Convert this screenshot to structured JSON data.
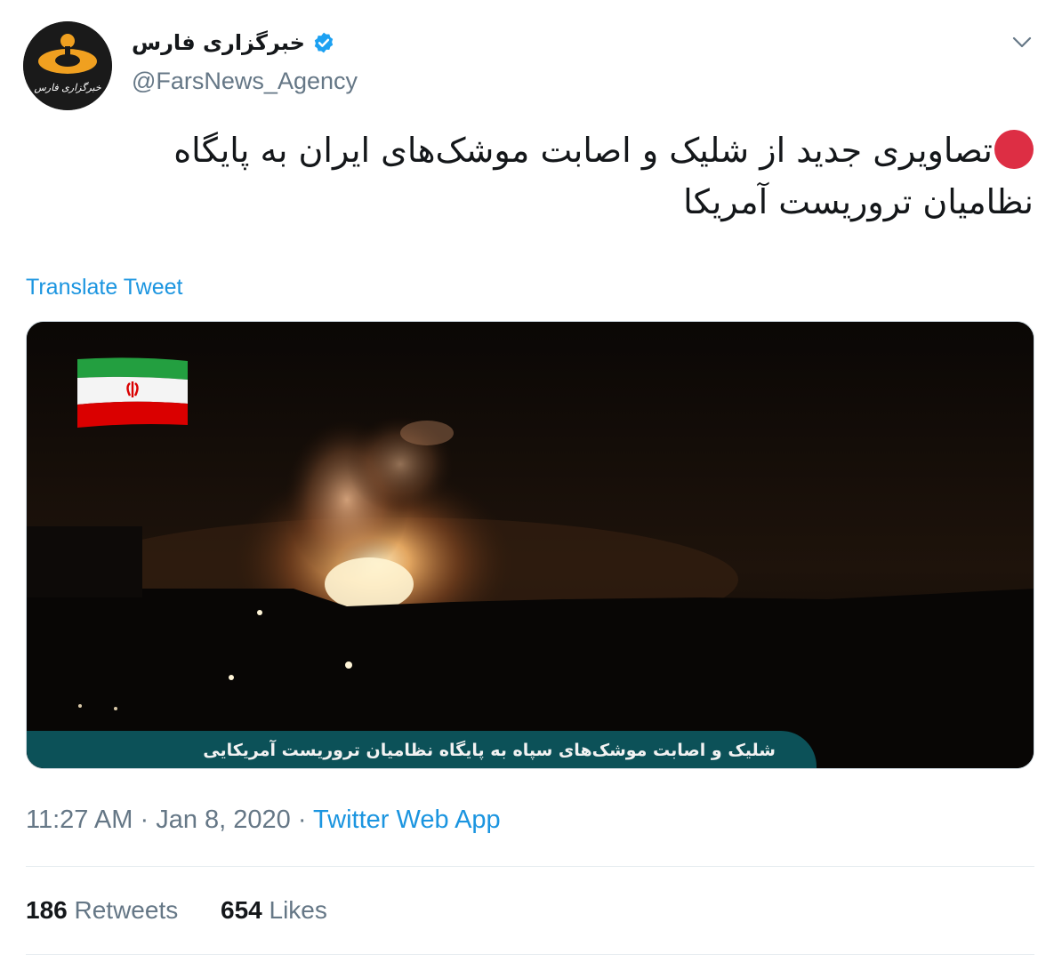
{
  "author": {
    "display_name": "خبرگزاری فارس",
    "handle": "@FarsNews_Agency",
    "verified": true,
    "avatar_text": "خبرگزاری فارس",
    "avatar_colors": {
      "background": "#1a1a1a",
      "logo": "#f0a020"
    }
  },
  "icons": {
    "verified": "verified-badge-icon",
    "more": "chevron-down-icon",
    "status": "red-circle-emoji"
  },
  "tweet": {
    "text": "تصاویری جدید از شلیک و اصابت موشک‌های ایران به پایگاه نظامیان تروریست آمریکا",
    "translate_label": "Translate Tweet"
  },
  "media": {
    "caption": "شلیک و اصابت موشک‌های سپاه به پایگاه نظامیان تروریست آمریکایی",
    "flag": "iran-flag"
  },
  "meta": {
    "time": "11:27 AM",
    "separator": "·",
    "date": "Jan 8, 2020",
    "source": "Twitter Web App"
  },
  "stats": {
    "retweets_count": "186",
    "retweets_label": "Retweets",
    "likes_count": "654",
    "likes_label": "Likes"
  },
  "colors": {
    "link": "#1b95e0",
    "secondary_text": "#657786",
    "primary_text": "#14171a",
    "verified": "#1da1f2",
    "red_dot": "#dd2e44",
    "caption_bar": "#0c5158"
  }
}
